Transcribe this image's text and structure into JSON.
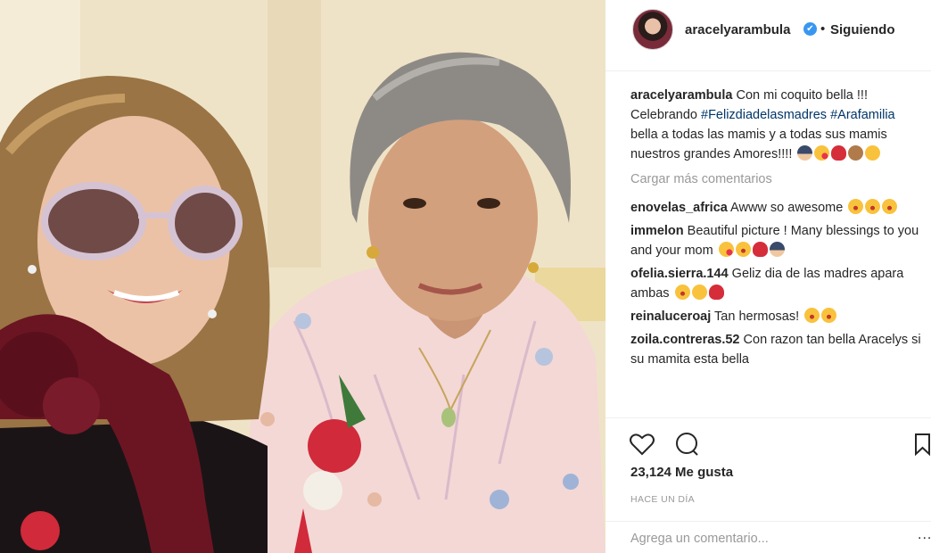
{
  "post": {
    "username": "aracelyarambula",
    "verified_mark": "✔",
    "separator": "•",
    "follow_status": "Siguiendo",
    "avatar_icon": "profile-avatar",
    "accent_color": "#3897f0",
    "hashtag_color": "#003569"
  },
  "caption": {
    "username": "aracelyarambula",
    "text_1": " Con mi coquito bella !!! Celebrando ",
    "hashtag_1": "#Felizdiadelasmadres",
    "text_2": " ",
    "hashtag_2": "#Arafamilia",
    "text_3": " bella a todas las mamis y a todas sus mamis nuestros grandes Amores!!!! "
  },
  "load_more": "Cargar más comentarios",
  "comments": [
    {
      "username": "enovelas_africa",
      "text": " Awww so awesome "
    },
    {
      "username": "immelon",
      "text": " Beautiful picture ! Many blessings to you and your mom "
    },
    {
      "username": "ofelia.sierra.144",
      "text": " Geliz dia de las madres apara ambas "
    },
    {
      "username": "reinaluceroaj",
      "text": " Tan hermosas! "
    },
    {
      "username": "zoila.contreras.52",
      "text": " Con razon tan bella Aracelys si su mamita esta bella"
    }
  ],
  "actions": {
    "like_icon": "heart-outline-icon",
    "comment_icon": "comment-bubble-icon",
    "save_icon": "bookmark-icon"
  },
  "likes": {
    "count": "23,124",
    "label": " Me gusta"
  },
  "time": "HACE UN DÍA",
  "add_comment": {
    "placeholder": "Agrega un comentario...",
    "more": "..."
  }
}
